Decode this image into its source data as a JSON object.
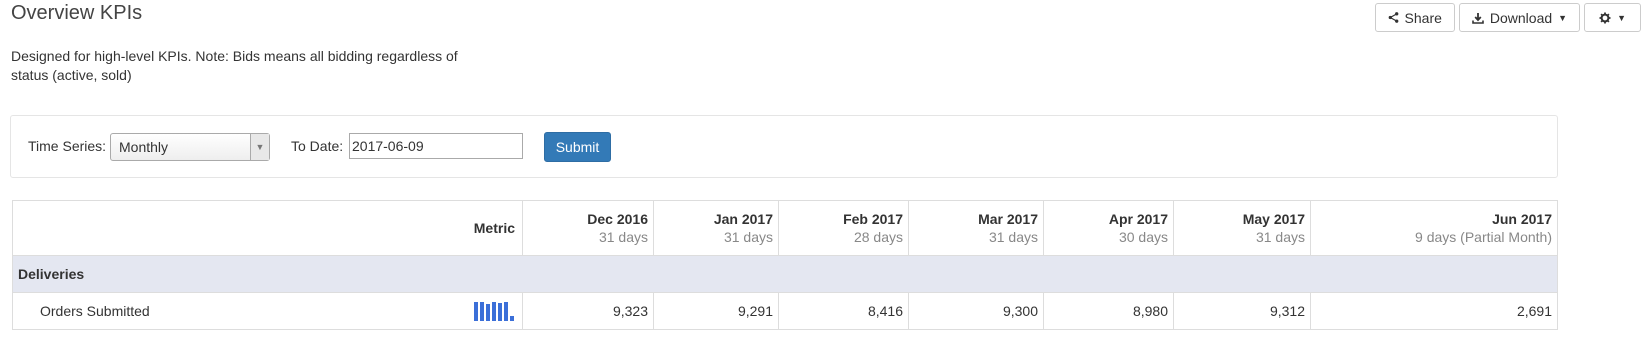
{
  "header": {
    "title": "Overview KPIs",
    "description": "Designed for high-level KPIs. Note: Bids means all bidding regardless of status (active, sold)"
  },
  "actions": {
    "share_label": "Share",
    "download_label": "Download",
    "share_icon": "share-icon",
    "download_icon": "download-icon",
    "settings_icon": "gear-icon"
  },
  "filters": {
    "time_series_label": "Time Series:",
    "time_series_value": "Monthly",
    "to_date_label": "To Date:",
    "to_date_value": "2017-06-09",
    "submit_label": "Submit"
  },
  "table": {
    "metric_header": "Metric",
    "columns": [
      {
        "month": "Dec 2016",
        "days": "31 days"
      },
      {
        "month": "Jan 2017",
        "days": "31 days"
      },
      {
        "month": "Feb 2017",
        "days": "28 days"
      },
      {
        "month": "Mar 2017",
        "days": "31 days"
      },
      {
        "month": "Apr 2017",
        "days": "30 days"
      },
      {
        "month": "May 2017",
        "days": "31 days"
      },
      {
        "month": "Jun 2017",
        "days": "9 days (Partial Month)"
      }
    ],
    "section": "Deliveries",
    "rows": [
      {
        "label": "Orders Submitted",
        "values": [
          "9,323",
          "9,291",
          "8,416",
          "9,300",
          "8,980",
          "9,312",
          "2,691"
        ],
        "sparkline": [
          9323,
          9291,
          8416,
          9300,
          8980,
          9312,
          2691
        ]
      }
    ]
  },
  "colors": {
    "accent": "#337ab7",
    "section_bg": "#e4e7f1",
    "sparkline": "#3b6fd8"
  }
}
